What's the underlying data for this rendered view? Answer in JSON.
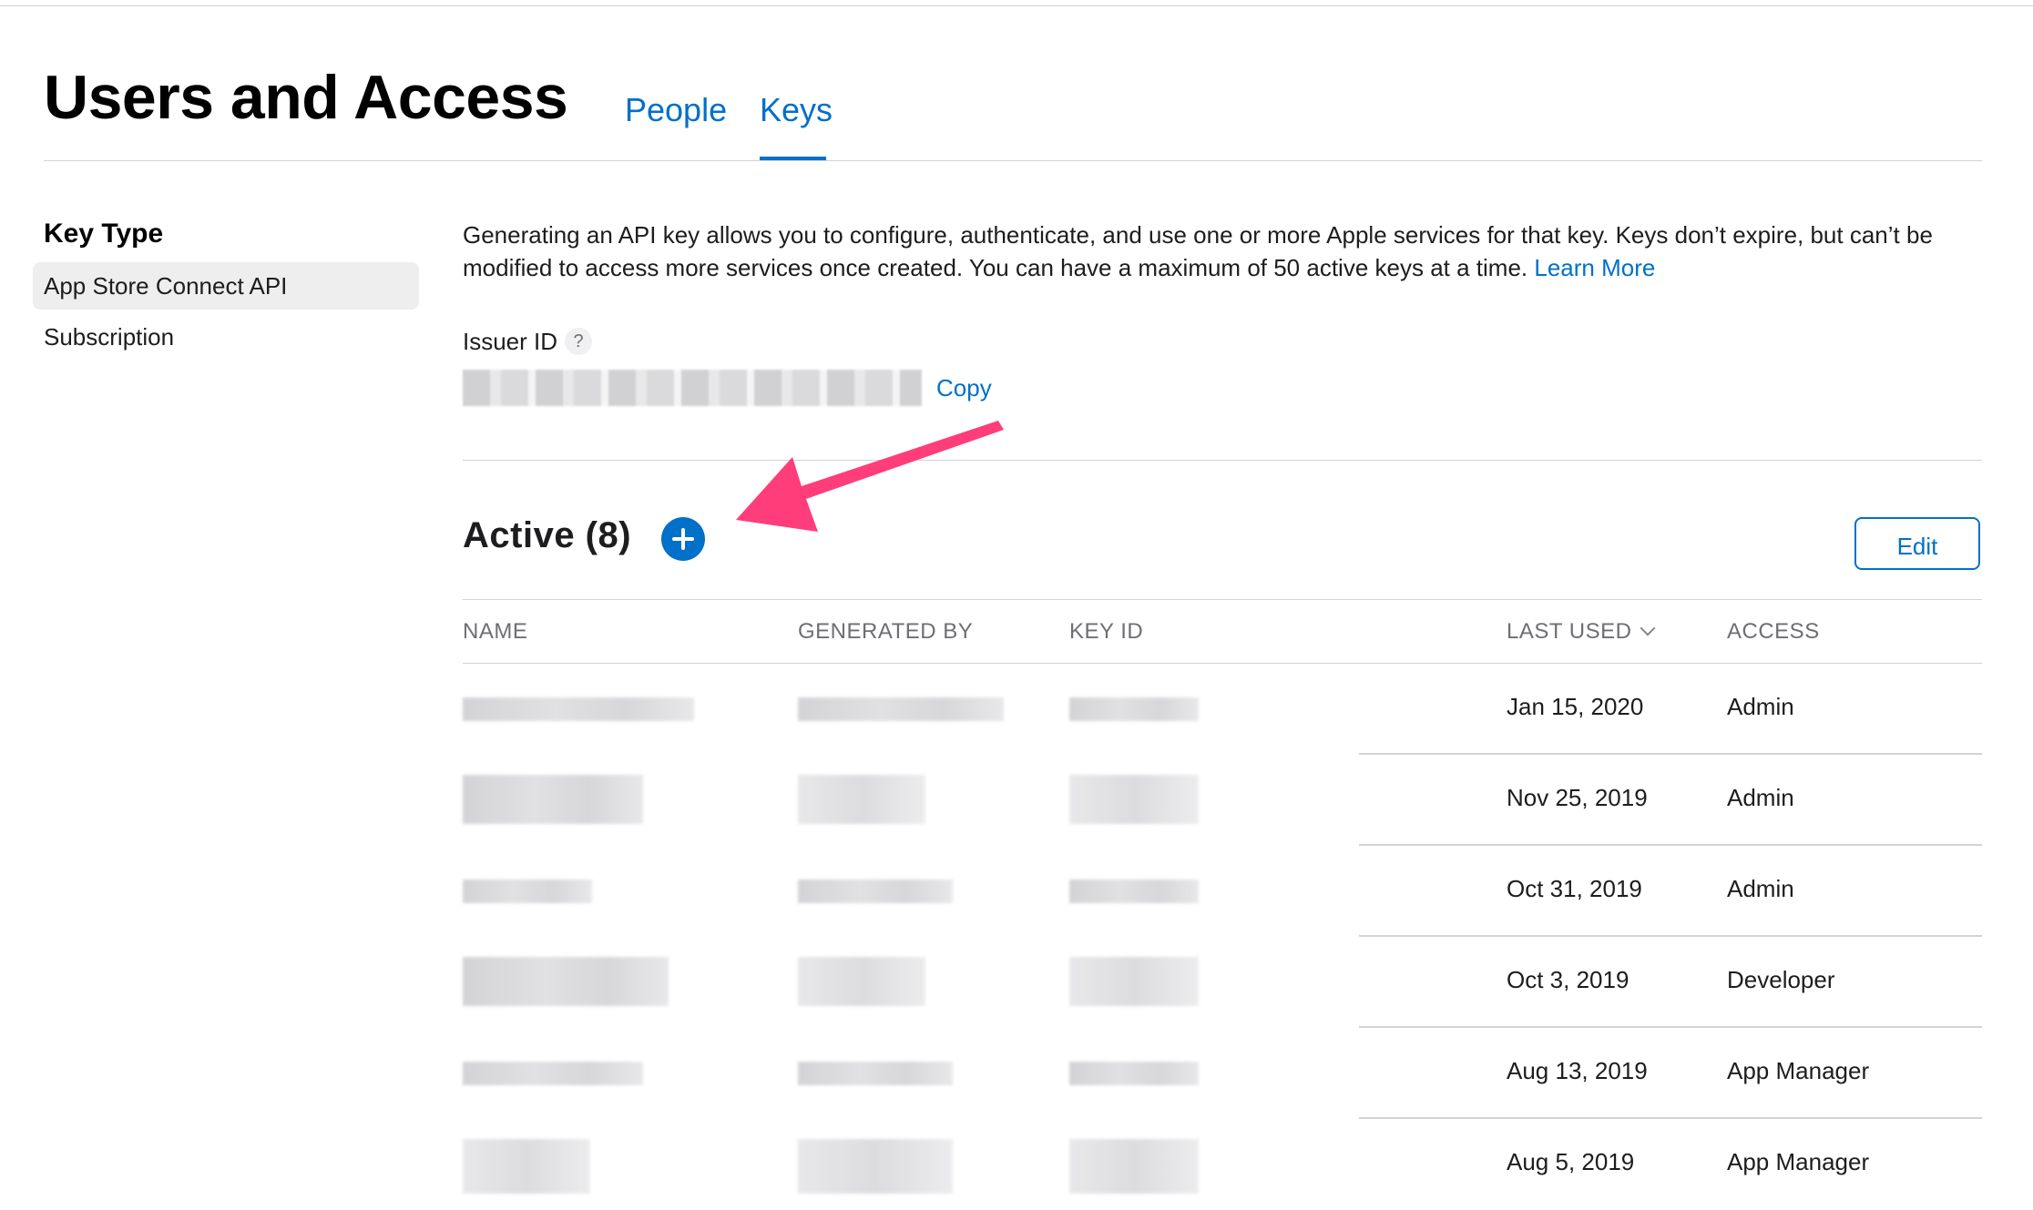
{
  "header": {
    "title": "Users and Access",
    "tabs": [
      {
        "label": "People",
        "active": false
      },
      {
        "label": "Keys",
        "active": true
      }
    ]
  },
  "sidebar": {
    "heading": "Key Type",
    "items": [
      {
        "label": "App Store Connect API",
        "selected": true
      },
      {
        "label": "Subscription",
        "selected": false
      }
    ]
  },
  "intro": {
    "text": "Generating an API key allows you to configure, authenticate, and use one or more Apple services for that key. Keys don’t expire, but can’t be modified to access more services once created. You can have a maximum of 50 active keys at a time.",
    "learn_more": "Learn More"
  },
  "issuer": {
    "label": "Issuer ID",
    "help": "?",
    "copy_label": "Copy"
  },
  "active_section": {
    "title": "Active (8)",
    "add_icon": "plus-circle-icon",
    "edit_label": "Edit"
  },
  "table": {
    "columns": [
      "NAME",
      "GENERATED BY",
      "KEY ID",
      "LAST USED",
      "ACCESS"
    ],
    "rows": [
      {
        "last_used": "Jan 15, 2020",
        "access": "Admin"
      },
      {
        "last_used": "Nov 25, 2019",
        "access": "Admin"
      },
      {
        "last_used": "Oct 31, 2019",
        "access": "Admin"
      },
      {
        "last_used": "Oct 3, 2019",
        "access": "Developer"
      },
      {
        "last_used": "Aug 13, 2019",
        "access": "App Manager"
      },
      {
        "last_used": "Aug 5, 2019",
        "access": "App Manager"
      }
    ]
  },
  "colors": {
    "accent": "#0070c9",
    "annotation_arrow": "#ff3d7a"
  }
}
